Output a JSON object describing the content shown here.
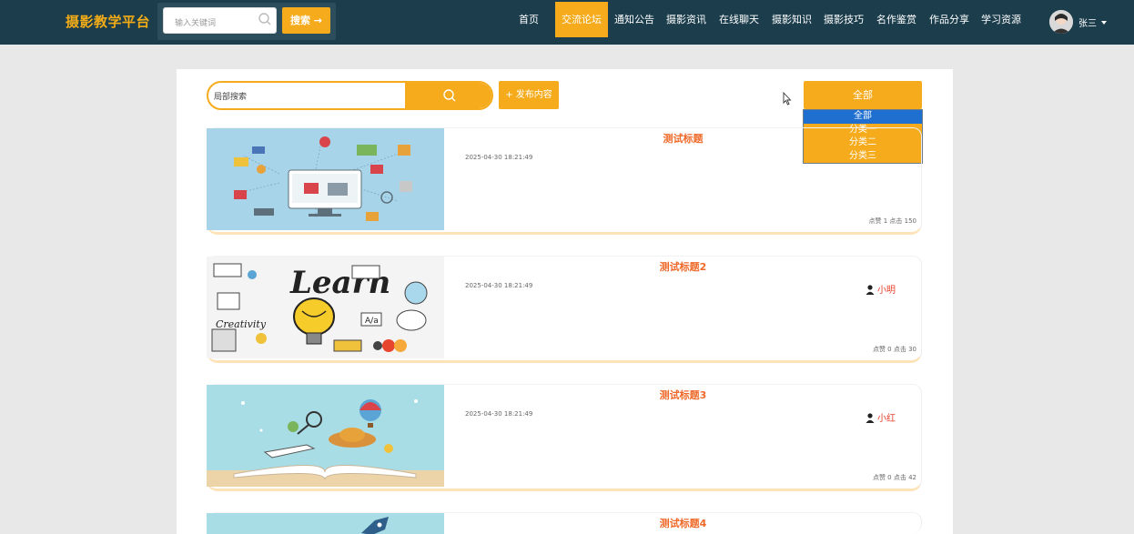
{
  "brand": "摄影教学平台",
  "top_search": {
    "placeholder": "输入关键词",
    "button": "搜索 →"
  },
  "nav": [
    {
      "label": "首页",
      "active": false
    },
    {
      "label": "交流论坛",
      "active": true
    },
    {
      "label": "通知公告",
      "active": false
    },
    {
      "label": "摄影资讯",
      "active": false
    },
    {
      "label": "在线聊天",
      "active": false
    },
    {
      "label": "摄影知识",
      "active": false
    },
    {
      "label": "摄影技巧",
      "active": false
    },
    {
      "label": "名作鉴赏",
      "active": false
    },
    {
      "label": "作品分享",
      "active": false
    },
    {
      "label": "学习资源",
      "active": false
    }
  ],
  "user": {
    "name": "张三"
  },
  "local_search": {
    "placeholder": "局部搜索"
  },
  "publish_button": "+ 发布内容",
  "category": {
    "selected": "全部",
    "options": [
      "全部",
      "分类一",
      "分类二",
      "分类三"
    ]
  },
  "posts": [
    {
      "title": "测试标题",
      "time": "2025-04-30 18:21:49",
      "author": "",
      "stats": "点赞 1  点击 150"
    },
    {
      "title": "测试标题2",
      "time": "2025-04-30 18:21:49",
      "author": "小明",
      "stats": "点赞 0  点击 30"
    },
    {
      "title": "测试标题3",
      "time": "2025-04-30 18:21:49",
      "author": "小红",
      "stats": "点赞 0  点击 42"
    },
    {
      "title": "测试标题4",
      "time": "",
      "author": "",
      "stats": ""
    }
  ],
  "colors": {
    "nav_bg": "#1b3d4c",
    "accent": "#f5ab1b",
    "title": "#ef6a2a"
  }
}
